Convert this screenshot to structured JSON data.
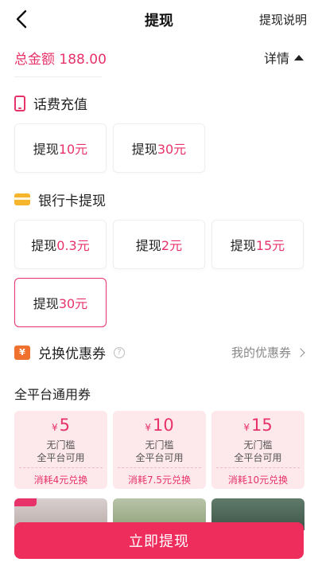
{
  "header": {
    "title": "提现",
    "help_label": "提现说明"
  },
  "balance": {
    "label": "总金额",
    "amount": "188.00",
    "detail_label": "详情"
  },
  "phone_topup": {
    "title": "话费充值",
    "options": [
      {
        "prefix": "提现",
        "amount": "10元"
      },
      {
        "prefix": "提现",
        "amount": "30元"
      }
    ]
  },
  "bank_card": {
    "title": "银行卡提现",
    "options": [
      {
        "prefix": "提现",
        "amount": "0.3元"
      },
      {
        "prefix": "提现",
        "amount": "2元"
      },
      {
        "prefix": "提现",
        "amount": "15元"
      },
      {
        "prefix": "提现",
        "amount": "30元",
        "selected": true
      }
    ]
  },
  "coupons": {
    "title": "兑换优惠券",
    "info_glyph": "?",
    "my_coupons_label": "我的优惠券",
    "category_label": "全平台通用券",
    "coupon_icon_glyph": "¥",
    "items": [
      {
        "currency": "¥",
        "value": "5",
        "condition": "无门槛",
        "scope": "全平台可用",
        "cost": "消耗4元兑换"
      },
      {
        "currency": "¥",
        "value": "10",
        "condition": "无门槛",
        "scope": "全平台可用",
        "cost": "消耗7.5元兑换"
      },
      {
        "currency": "¥",
        "value": "15",
        "condition": "无门槛",
        "scope": "全平台可用",
        "cost": "消耗10元兑换"
      }
    ]
  },
  "action": {
    "withdraw_label": "立即提现"
  },
  "colors": {
    "accent": "#e8336a",
    "button": "#ee2d5d",
    "coupon_bg": "#fde8ec",
    "card_icon": "#f6b52b",
    "coupon_icon": "#f0702e"
  }
}
